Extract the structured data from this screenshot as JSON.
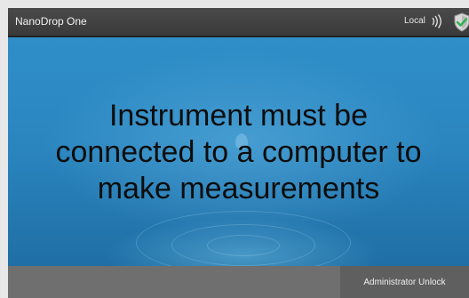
{
  "titlebar": {
    "app_title": "NanoDrop One",
    "connection_status": "Local",
    "signal_icon": "wireless-signal-icon",
    "security_icon": "shield-check-icon"
  },
  "main": {
    "message": "Instrument must be\nconnected to a computer to\nmake measurements",
    "background_color": "#2b86c0",
    "text_color": "#0d0d0d"
  },
  "bottombar": {
    "admin_unlock_label": "Administrator Unlock",
    "background_color": "#6f6f6f"
  }
}
